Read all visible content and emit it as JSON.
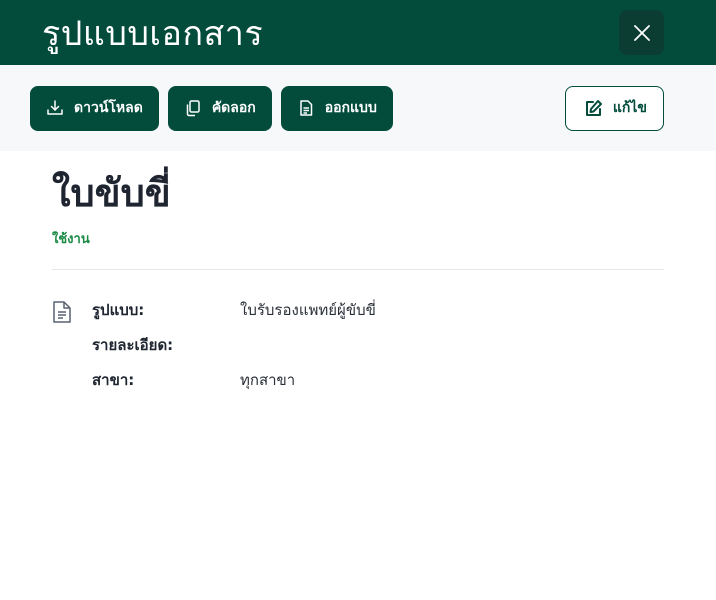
{
  "header": {
    "title": "รูปแบบเอกสาร"
  },
  "toolbar": {
    "download_label": "ดาวน์โหลด",
    "copy_label": "คัดลอก",
    "design_label": "ออกแบบ",
    "edit_label": "แก้ไข"
  },
  "document": {
    "title": "ใบขับขี่",
    "status": "ใช้งาน",
    "details": [
      {
        "label": "รูปแบบ:",
        "value": "ใบรับรองแพทย์ผู้ขับขี่"
      },
      {
        "label": "รายละเอียด:",
        "value": ""
      },
      {
        "label": "สาขา:",
        "value": "ทุกสาขา"
      }
    ]
  },
  "colors": {
    "brand": "#034c3c",
    "status": "#1a8a45"
  },
  "icons": {
    "close": "close-icon",
    "download": "download-icon",
    "copy": "copy-icon",
    "design": "document-icon",
    "edit": "edit-icon",
    "details": "file-text-icon"
  }
}
